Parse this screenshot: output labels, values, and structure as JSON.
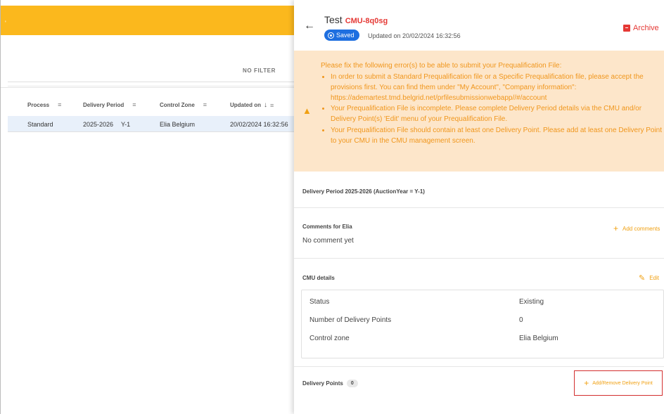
{
  "background": {
    "no_filter": "NO FILTER",
    "columns": {
      "process": "Process",
      "delivery_period": "Delivery Period",
      "control_zone": "Control Zone",
      "updated_on": "Updated on"
    },
    "row": {
      "process": "Standard",
      "delivery_period": "2025-2026",
      "auction_year": "Y-1",
      "control_zone": "Elia Belgium",
      "updated_on": "20/02/2024 16:32:56"
    },
    "colors": {
      "header_bar": "#fbb81d",
      "selected_row": "#e8f0fa"
    }
  },
  "panel": {
    "title": "Test",
    "cmu_id": "CMU-8q0sg",
    "saved_label": "Saved",
    "updated_text": "Updated on 20/02/2024 16:32:56",
    "archive_label": "Archive",
    "errors": {
      "heading": "Please fix the following error(s) to be able to submit your Prequalification File:",
      "items": [
        "In order to submit a Standard Prequalification file or a Specific Prequalification file, please accept the provisions first. You can find them under \"My Account\", \"Company information\": https://ademartest.tmd.belgrid.net/prfilesubmissionwebapp//#/account",
        "Your Prequalification File is incomplete. Please complete Delivery Period details via the CMU and/or Delivery Point(s) 'Edit' menu of your Prequalification File.",
        "Your Prequalification File should contain at least one Delivery Point. Please add at least one Delivery Point to your CMU in the CMU management screen."
      ]
    },
    "delivery_period_title": "Delivery Period 2025-2026 (AuctionYear = Y-1)",
    "comments": {
      "title": "Comments for Elia",
      "add_label": "Add comments",
      "empty_text": "No comment yet"
    },
    "cmu_details": {
      "title": "CMU details",
      "edit_label": "Edit",
      "rows": [
        {
          "label": "Status",
          "value": "Existing"
        },
        {
          "label": "Number of Delivery Points",
          "value": "0"
        },
        {
          "label": "Control zone",
          "value": "Elia Belgium"
        }
      ]
    },
    "delivery_points": {
      "title": "Delivery Points",
      "count": "0",
      "add_remove_label": "Add/Remove Delivery Point"
    },
    "colors": {
      "error_bg": "#fde6ca",
      "error_text": "#f0961c",
      "accent": "#f0a012",
      "danger": "#e53935",
      "saved": "#1e6fe0"
    }
  }
}
